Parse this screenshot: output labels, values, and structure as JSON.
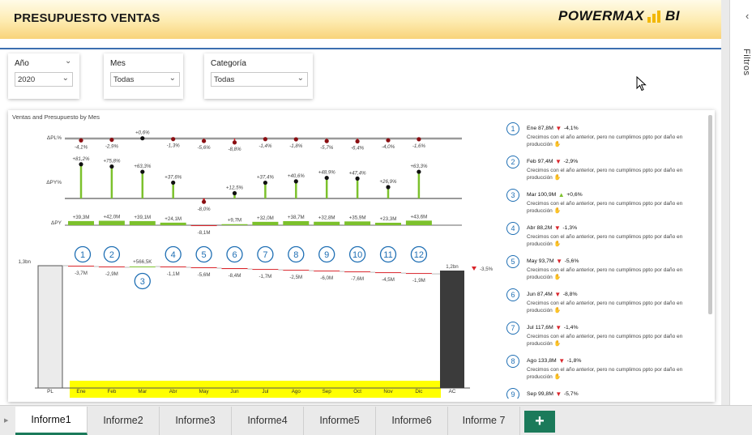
{
  "header": {
    "title": "PRESUPUESTO VENTAS",
    "logo_left": "POWERMAX",
    "logo_right": "BI"
  },
  "slicers": [
    {
      "title": "Año",
      "value": "2020"
    },
    {
      "title": "Mes",
      "value": "Todas"
    },
    {
      "title": "Categoría",
      "value": "Todas"
    }
  ],
  "filters_pane": {
    "label": "Filtros"
  },
  "colors": {
    "accent_blue": "#1f6fb4",
    "positive_green": "#7cc12c",
    "negative_red": "#d9242a",
    "highlight_yellow": "#ffff00",
    "bar_dark": "#3b3b3b",
    "bar_light": "#ebebeb"
  },
  "chart_data": {
    "type": "waterfall",
    "title": "Ventas and Presupuesto by Mes",
    "row_labels": {
      "dpl_pct": "ΔPL%",
      "dpy_pct": "ΔPY%",
      "dpy": "ΔPY"
    },
    "categories": [
      "Ene",
      "Feb",
      "Mar",
      "Abr",
      "May",
      "Jun",
      "Jul",
      "Ago",
      "Sep",
      "Oct",
      "Nov",
      "Dic"
    ],
    "start_label": "PL",
    "end_label": "AC",
    "start_value_label": "1,3bn",
    "end_value_label": "1,2bn",
    "total_variance_label": "-3,5%",
    "start_value": 1.3,
    "end_value": 1.2,
    "dpl_pct_values": [
      -4.1,
      -2.9,
      0.6,
      -1.3,
      -5.6,
      -8.8,
      -1.4,
      -1.8,
      -5.7,
      -6.4,
      -4.0,
      -1.6
    ],
    "dpl_pct_labels": [
      "-4,1%",
      "-2,9%",
      "+0,6%",
      "-1,3%",
      "-5,6%",
      "-8,8%",
      "-1,4%",
      "-1,8%",
      "-5,7%",
      "-6,4%",
      "-4,0%",
      "-1,6%"
    ],
    "dpy_pct_values": [
      81.2,
      75.8,
      63.3,
      37.6,
      -8.0,
      12.5,
      37.4,
      40.6,
      48.9,
      47.4,
      26.9,
      63.3
    ],
    "dpy_pct_labels": [
      "+81,2%",
      "+75,8%",
      "+63,3%",
      "+37,6%",
      "-8,0%",
      "+12,5%",
      "+37,4%",
      "+40,6%",
      "+48,9%",
      "+47,4%",
      "+26,9%",
      "+63,3%"
    ],
    "dpy_values_m": [
      39.3,
      42.0,
      39.1,
      24.1,
      -8.1,
      9.7,
      32.0,
      38.7,
      32.8,
      35.9,
      23.3,
      43.6
    ],
    "dpy_labels": [
      "+39,3M",
      "+42,0M",
      "+39,1M",
      "+24,1M",
      "-8,1M",
      "+9,7M",
      "+32,0M",
      "+38,7M",
      "+32,8M",
      "+35,9M",
      "+23,3M",
      "+43,6M"
    ],
    "waterfall_values_m": [
      -3.7,
      -2.9,
      0.5665,
      -1.1,
      -5.6,
      -8.4,
      -1.7,
      -2.5,
      -6.0,
      -7.6,
      -4.5,
      -1.9
    ],
    "waterfall_labels": [
      "-3,7M",
      "-2,9M",
      "+566,5K",
      "-1,1M",
      "-5,6M",
      "-8,4M",
      "-1,7M",
      "-2,5M",
      "-6,0M",
      "-7,6M",
      "-4,5M",
      "-1,9M"
    ],
    "markers": [
      "1",
      "2",
      "3",
      "4",
      "5",
      "6",
      "7",
      "8",
      "9",
      "10",
      "11",
      "12"
    ]
  },
  "comments": [
    {
      "num": "1",
      "head": "Ene 87,8M",
      "dir": "down",
      "delta": "-4,1%",
      "text": "Crecimos con el año anterior, pero no cumplimos ppto por daño en producción"
    },
    {
      "num": "2",
      "head": "Feb 97,4M",
      "dir": "down",
      "delta": "-2,9%",
      "text": "Crecimos con el año anterior, pero no cumplimos ppto por daño en producción"
    },
    {
      "num": "3",
      "head": "Mar 100,9M",
      "dir": "up",
      "delta": "+0,6%",
      "text": "Crecimos con el año anterior, pero no cumplimos ppto por daño en producción"
    },
    {
      "num": "4",
      "head": "Abr 88,2M",
      "dir": "down",
      "delta": "-1,3%",
      "text": "Crecimos con el año anterior, pero no cumplimos ppto por daño en producción"
    },
    {
      "num": "5",
      "head": "May 93,7M",
      "dir": "down",
      "delta": "-5,6%",
      "text": "Crecimos con el año anterior, pero no cumplimos ppto por daño en producción"
    },
    {
      "num": "6",
      "head": "Jun 87,4M",
      "dir": "down",
      "delta": "-8,8%",
      "text": "Crecimos con el año anterior, pero no cumplimos ppto por daño en producción"
    },
    {
      "num": "7",
      "head": "Jul 117,6M",
      "dir": "down",
      "delta": "-1,4%",
      "text": "Crecimos con el año anterior, pero no cumplimos ppto por daño en producción"
    },
    {
      "num": "8",
      "head": "Ago 133,8M",
      "dir": "down",
      "delta": "-1,8%",
      "text": "Crecimos con el año anterior, pero no cumplimos ppto por daño en producción"
    },
    {
      "num": "9",
      "head": "Sep 99,8M",
      "dir": "down",
      "delta": "-5,7%",
      "text": ""
    }
  ],
  "tabs": [
    "Informe1",
    "Informe2",
    "Informe3",
    "Informe4",
    "Informe5",
    "Informe6",
    "Informe 7"
  ],
  "add_page_label": "+"
}
